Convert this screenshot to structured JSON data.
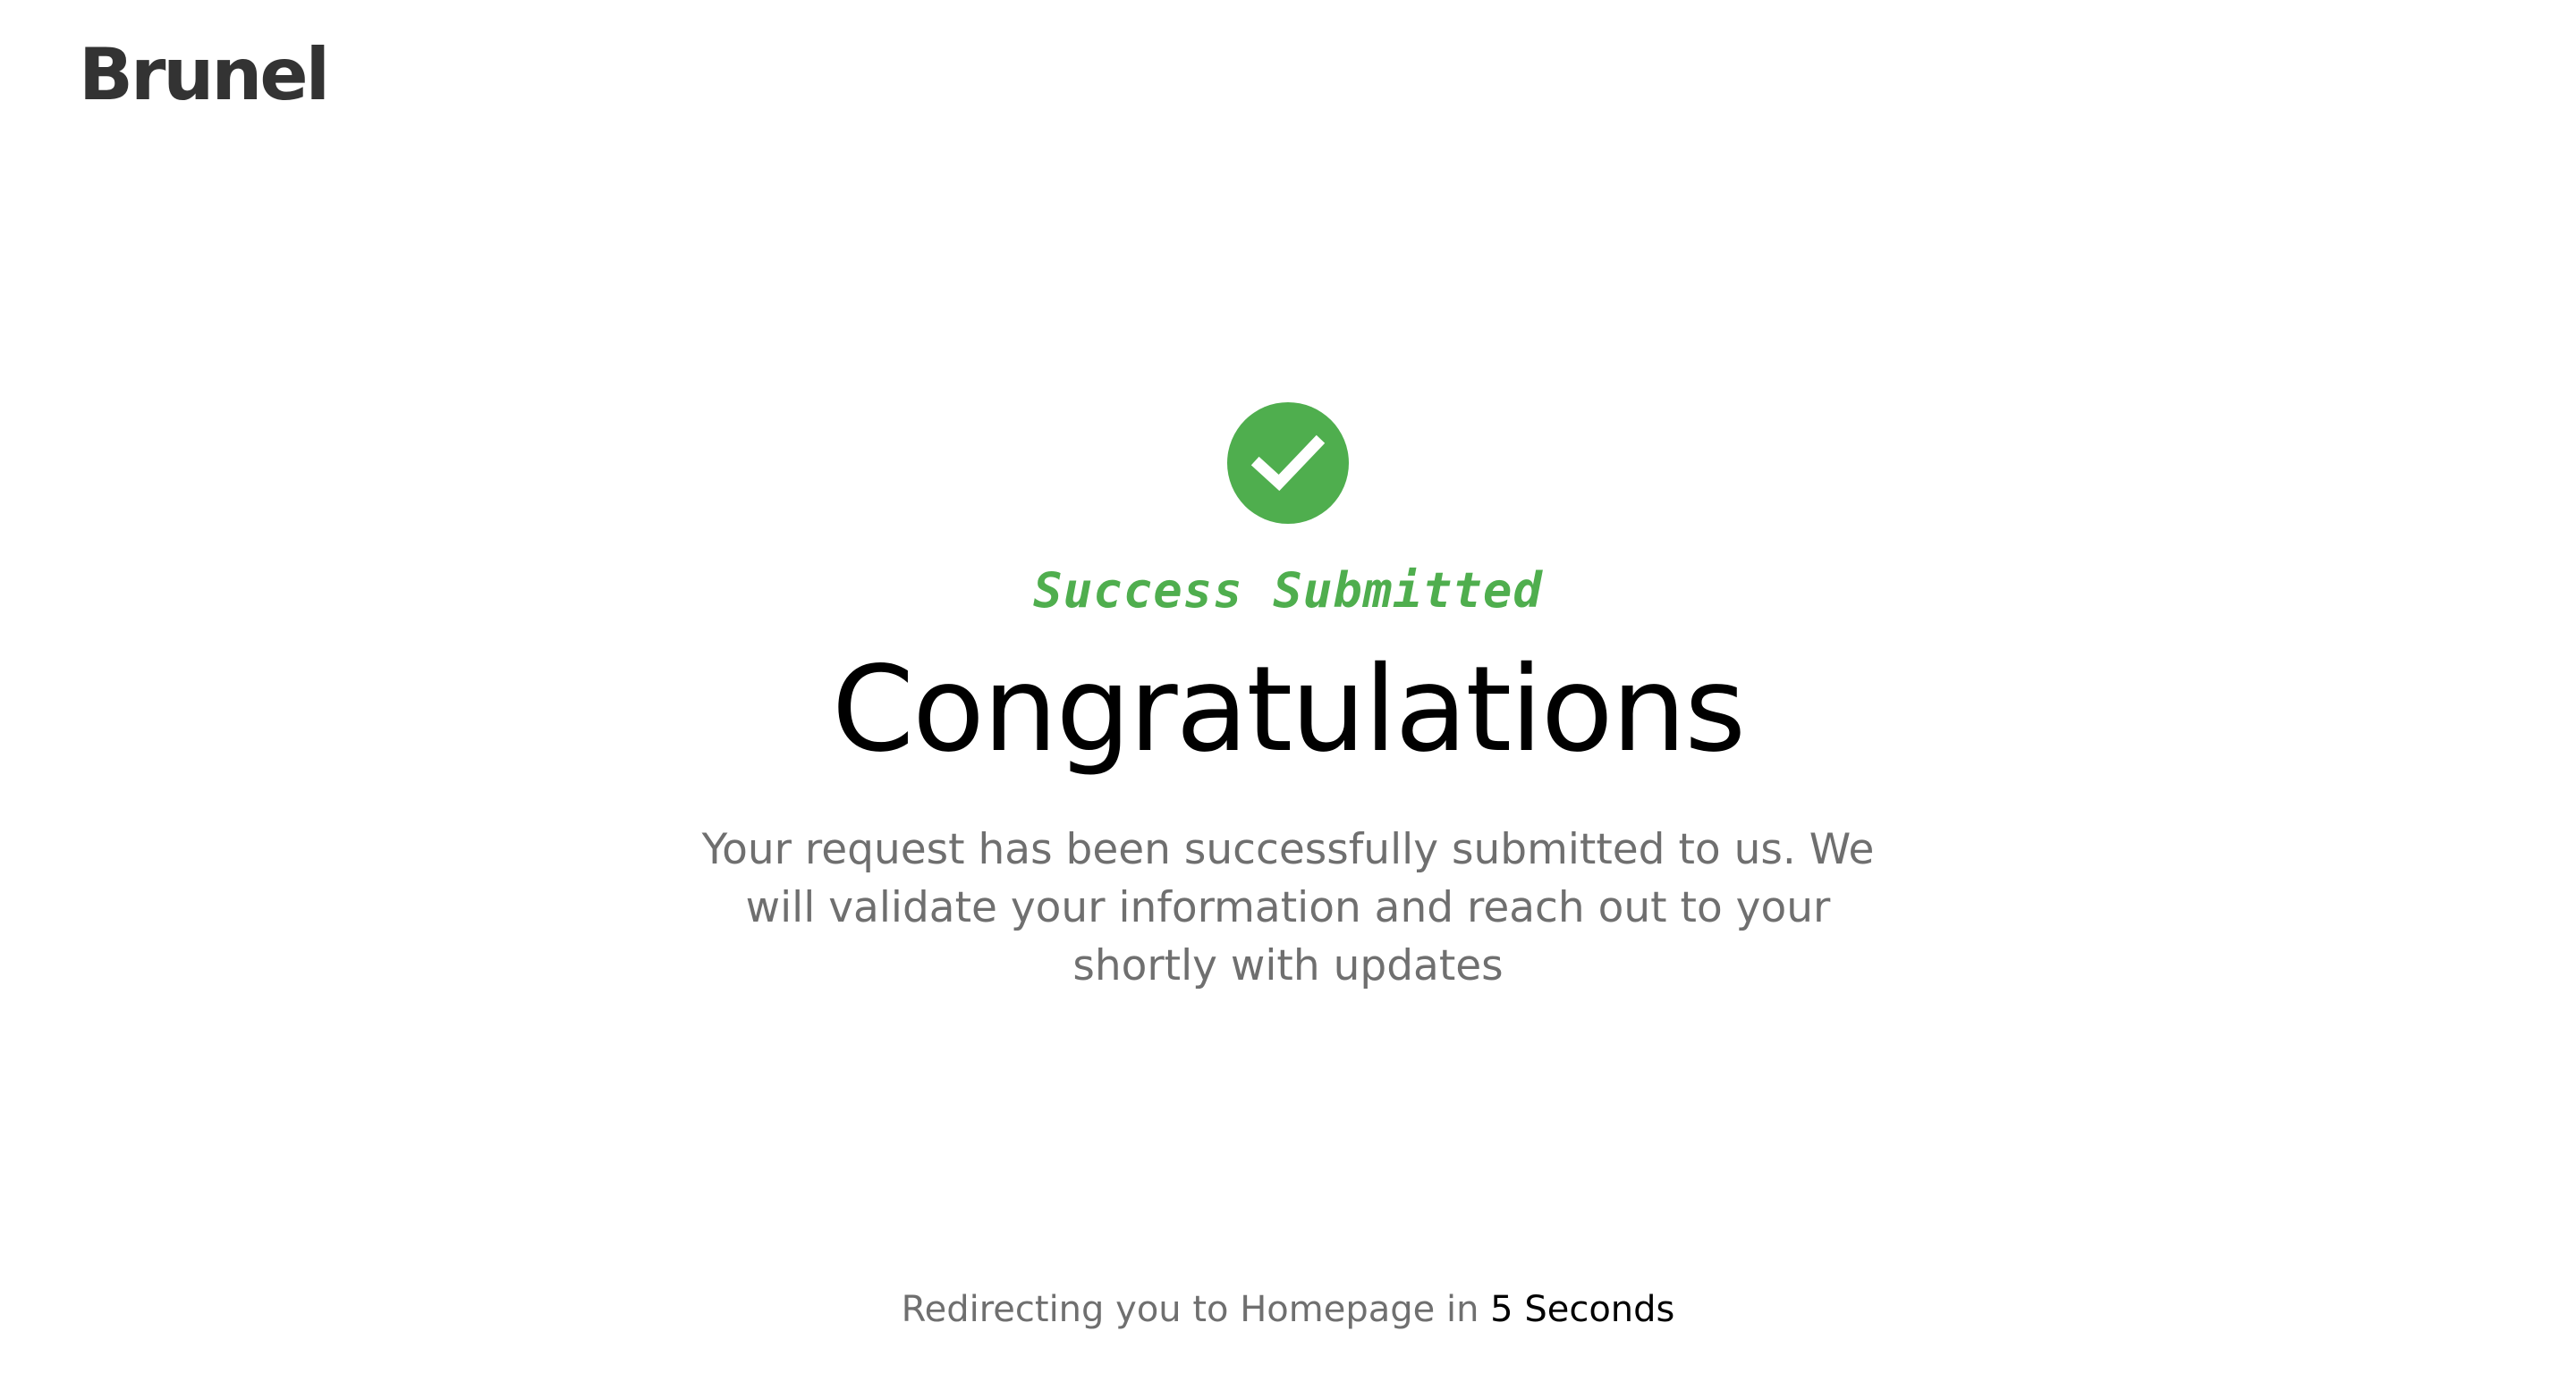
{
  "brand": {
    "logo_text": "Brunel"
  },
  "status": {
    "icon": "check-circle-icon",
    "kicker": "Success Submitted",
    "headline": "Congratulations",
    "message": "Your request has been successfully submitted to us. We will validate your information and reach out to your shortly with updates"
  },
  "redirect": {
    "prefix": "Redirecting you to Homepage in",
    "countdown": "5 Seconds"
  },
  "colors": {
    "success": "#4fae4e",
    "text_muted": "#6f6f6f",
    "logo": "#333333"
  }
}
